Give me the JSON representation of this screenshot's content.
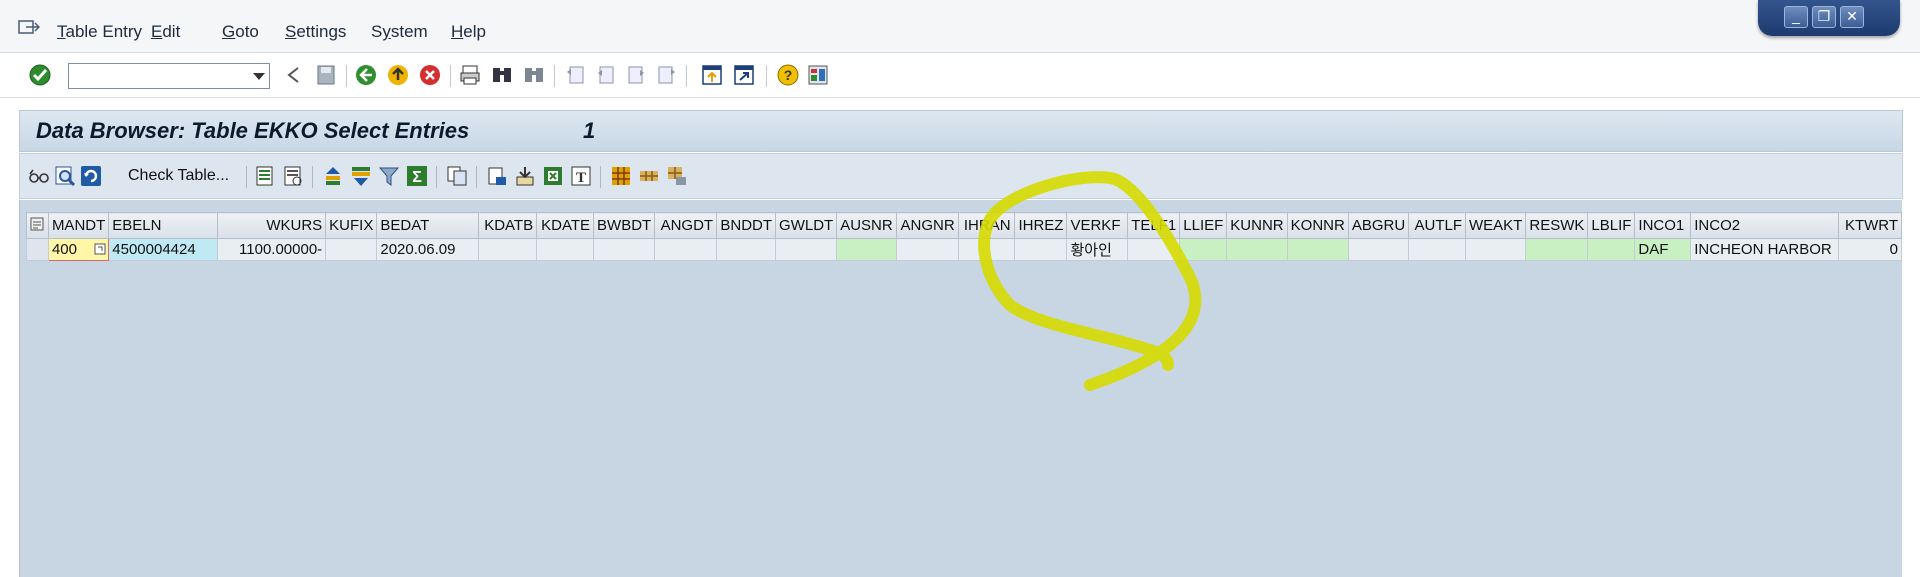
{
  "menubar": {
    "items": [
      {
        "label": "Table Entry",
        "ul": "T"
      },
      {
        "label": "Edit",
        "ul": "E"
      },
      {
        "label": "Goto",
        "ul": "G"
      },
      {
        "label": "Settings",
        "ul": "S"
      },
      {
        "label": "System",
        "ul": "y"
      },
      {
        "label": "Help",
        "ul": "H"
      }
    ],
    "window_buttons": [
      "minimize",
      "restore",
      "close"
    ]
  },
  "toolbar": {
    "command_field_value": ""
  },
  "title": {
    "text": "Data Browser: Table EKKO Select Entries",
    "count": "1"
  },
  "app_toolbar": {
    "check_table_label": "Check Table..."
  },
  "grid": {
    "columns": [
      "MANDT",
      "EBELN",
      "WKURS",
      "KUFIX",
      "BEDAT",
      "KDATB",
      "KDATE",
      "BWBDT",
      "ANGDT",
      "BNDDT",
      "GWLDT",
      "AUSNR",
      "ANGNR",
      "IHRAN",
      "IHREZ",
      "VERKF",
      "TELF1",
      "LLIEF",
      "KUNNR",
      "KONNR",
      "ABGRU",
      "AUTLF",
      "WEAKT",
      "RESWK",
      "LBLIF",
      "INCO1",
      "INCO2",
      "KTWRT"
    ],
    "rows": [
      [
        "400",
        "4500004424",
        "1100.00000-",
        "",
        "2020.06.09",
        "",
        "",
        "",
        "",
        "",
        "",
        "",
        "",
        "",
        "",
        "황아인",
        "",
        "",
        "",
        "",
        "",
        "",
        "",
        "",
        "",
        "DAF",
        "INCHEON HARBOR",
        "0"
      ]
    ]
  },
  "colors": {
    "annotation": "#d9dc00",
    "title_bg": "#c8d7e6",
    "grid_bg": "#c8d6e3",
    "key_cell": "#fff6a8",
    "key_cell2": "#bfeaf3",
    "green_cell": "#c9f0c2"
  }
}
